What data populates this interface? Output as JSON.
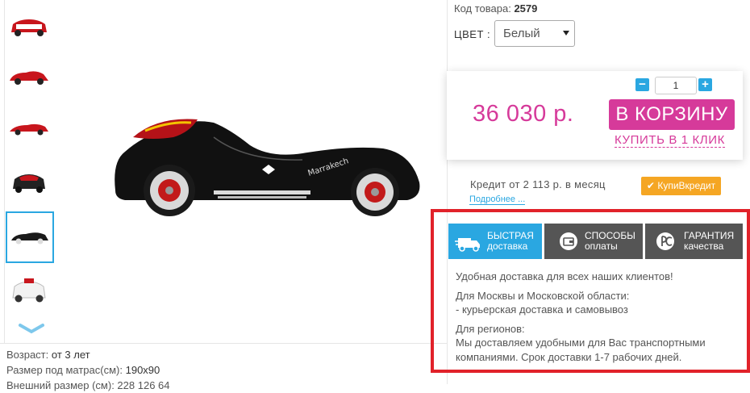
{
  "product": {
    "code_label": "Код товара:",
    "code_value": "2579",
    "color_label": "ЦВЕТ :",
    "color_selected": "Белый"
  },
  "purchase": {
    "qty": "1",
    "price": "36 030 р.",
    "cart_label": "В КОРЗИНУ",
    "one_click_label": "КУПИТЬ В 1 КЛИК"
  },
  "credit": {
    "text": "Кредит от 2 113 р. в месяц",
    "more_link": "Подробнее ...",
    "badge": "КупиВкредит"
  },
  "tabs": [
    {
      "line1": "БЫСТРАЯ",
      "line2": "доставка",
      "icon": "delivery-icon",
      "active": true
    },
    {
      "line1": "СПОСОБЫ",
      "line2": "оплаты",
      "icon": "wallet-icon",
      "active": false
    },
    {
      "line1": "ГАРАНТИЯ",
      "line2": "качества",
      "icon": "rst-certificate-icon",
      "active": false
    }
  ],
  "delivery_info": {
    "p1": "Удобная доставка для всех наших клиентов!",
    "p2_l1": "Для Москвы и Московской области:",
    "p2_l2": "- курьерская доставка и самовывоз",
    "p3_l1": "Для регионов:",
    "p3_l2": "Мы доставляем удобными для Вас транспортными компаниями. Срок доставки 1-7 рабочих дней."
  },
  "specs": {
    "age_label": "Возраст:",
    "age_value": "от 3 лет",
    "size_label": "Размер под матрас(см):",
    "size_value": "190x90",
    "dims_partial": "Внешний размер (см): 228 126 64"
  },
  "colors": {
    "accent_blue": "#2aa7e1",
    "brand_pink": "#d63a9a",
    "tab_dark": "#555555",
    "credit_orange": "#f5a623",
    "highlight_red": "#e1222a"
  }
}
